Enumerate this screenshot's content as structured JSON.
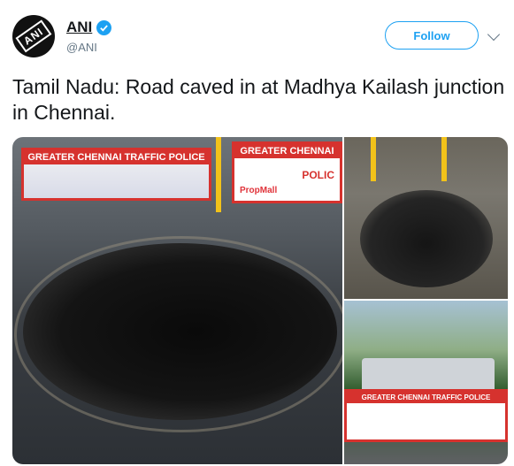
{
  "account": {
    "name": "ANI",
    "handle": "@ANI",
    "avatar_text": "ANI",
    "verified": true
  },
  "follow_button": {
    "label": "Follow"
  },
  "tweet": {
    "text": "Tamil Nadu: Road caved in at Madhya Kailash junction in Chennai."
  },
  "media": {
    "banner_title": "GREATER CHENNAI",
    "banner_police": "POLIC",
    "banner_left_text": "GREATER CHENNAI TRAFFIC POLICE",
    "sponsor": "PropMall",
    "banner_bottom_title": "GREATER CHENNAI TRAFFIC POLICE"
  },
  "colors": {
    "accent": "#1da1f2",
    "text": "#14171a",
    "secondary": "#657786"
  }
}
